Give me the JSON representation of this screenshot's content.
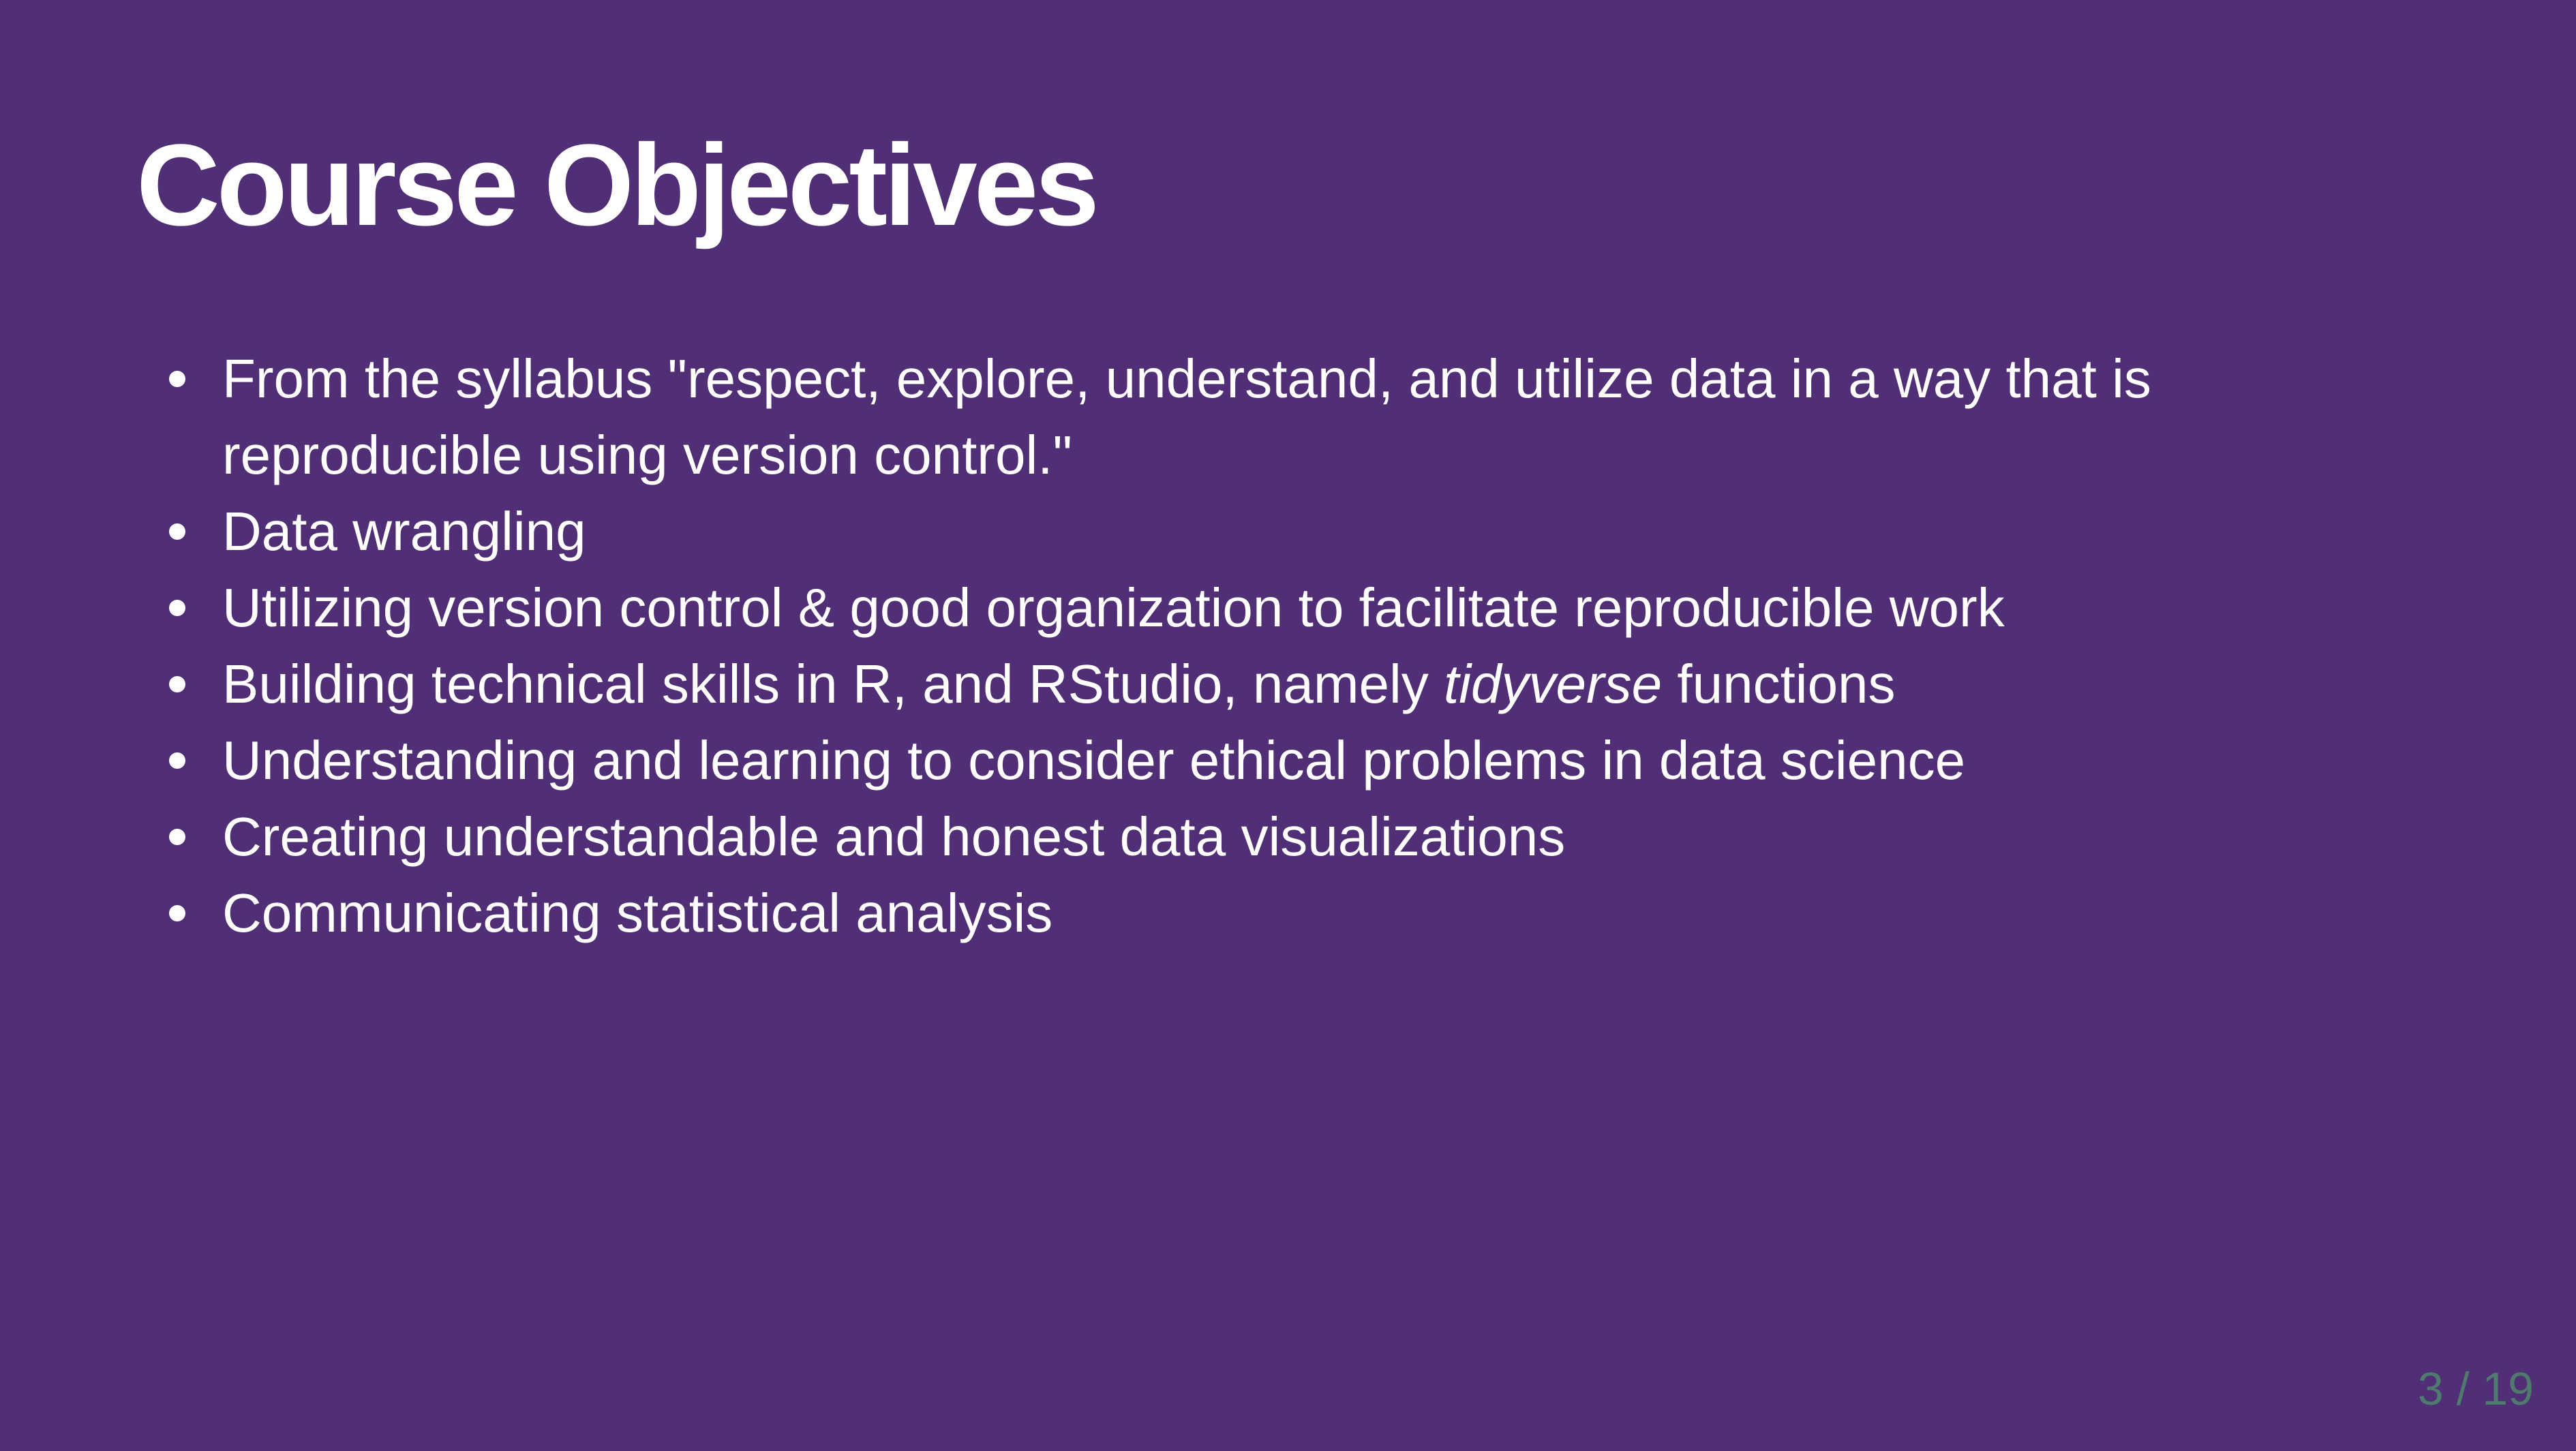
{
  "slide": {
    "title": "Course Objectives",
    "objectives": [
      {
        "text": "From the syllabus \"respect, explore, understand, and utilize data in a way that is reproducible using version control.\""
      },
      {
        "text": "Data wrangling"
      },
      {
        "text": "Utilizing version control & good organization to facilitate reproducible work"
      },
      {
        "before": "Building technical skills in R, and RStudio, namely ",
        "emphasis": "tidyverse",
        "after": " functions"
      },
      {
        "text": "Understanding and learning to consider ethical problems in data science"
      },
      {
        "text": "Creating understandable and honest data visualizations"
      },
      {
        "text": "Communicating statistical analysis"
      }
    ],
    "page_counter": "3 / 19"
  },
  "colors": {
    "background": "#512F76",
    "text": "#FFFFFF",
    "page_counter": "#4F7A6E"
  }
}
